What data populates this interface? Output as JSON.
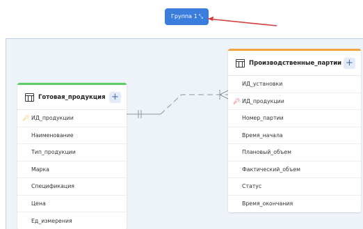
{
  "group_label": "Группа 1",
  "tables": [
    {
      "name": "Готовая_продукция",
      "header_color": "#5ccf63",
      "fields": [
        {
          "label": "ИД_продукции",
          "key": "primary"
        },
        {
          "label": "Наименование"
        },
        {
          "label": "Тип_продукции"
        },
        {
          "label": "Марка"
        },
        {
          "label": "Спецификация"
        },
        {
          "label": "Цена"
        },
        {
          "label": "Ед_измерения"
        }
      ]
    },
    {
      "name": "Производственные_партии",
      "header_color": "#f4a340",
      "fields": [
        {
          "label": "ИД_установки"
        },
        {
          "label": "ИД_продукции",
          "key": "foreign"
        },
        {
          "label": "Номер_партии"
        },
        {
          "label": "Время_начала"
        },
        {
          "label": "Плановый_объем"
        },
        {
          "label": "Фактический_объем"
        },
        {
          "label": "Статус"
        },
        {
          "label": "Время_окончания"
        }
      ]
    }
  ],
  "add_label": "+",
  "colors": {
    "canvas": "#eef2f9",
    "badge": "#3b7ddd",
    "arrow": "#d63b3b",
    "primary_key": "#f1b434",
    "foreign_key": "#e0474c",
    "relation_line": "#8f96a0"
  },
  "icons": {
    "group_resize": "resize-icon",
    "table": "table-icon",
    "add": "plus-icon",
    "primary_key": "key-icon",
    "foreign_key": "key-icon"
  },
  "relation": {
    "from": "Готовая_продукция.ИД_продукции",
    "to": "Производственные_партии.ИД_продукции",
    "from_cardinality": "one",
    "to_cardinality": "many"
  }
}
